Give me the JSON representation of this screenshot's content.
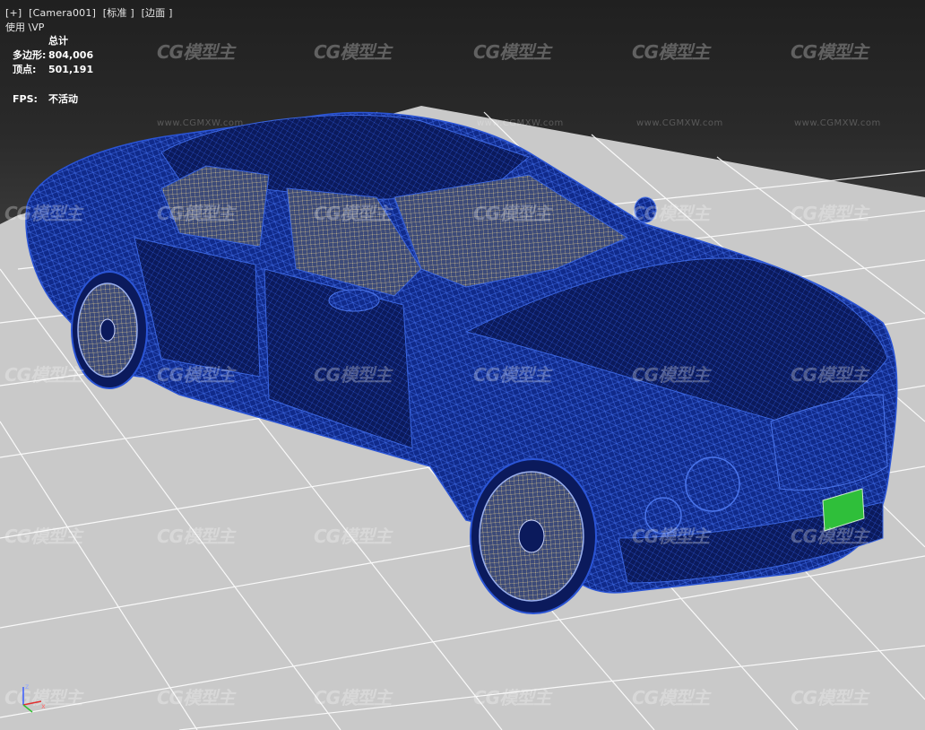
{
  "viewport": {
    "labels": [
      "[+]",
      "[Camera001]",
      "[标准 ]",
      "[边面 ]"
    ],
    "subtitle": "使用 \\VP"
  },
  "stats": {
    "header": "总计",
    "polygons_label": "多边形:",
    "polygons_value": "804,006",
    "vertices_label": "顶点:",
    "vertices_value": "501,191"
  },
  "fps": {
    "label": "FPS:",
    "value": "不活动"
  },
  "watermark": {
    "logo": "CG模型主",
    "url": "www.CGMXW.com"
  },
  "colors": {
    "wire": "#1a3fae",
    "ground": "#c8c8c8",
    "grid": "#ffffff",
    "plate": "#2fbf3a"
  },
  "axis": {
    "z_label": "z",
    "x_label": "x"
  }
}
